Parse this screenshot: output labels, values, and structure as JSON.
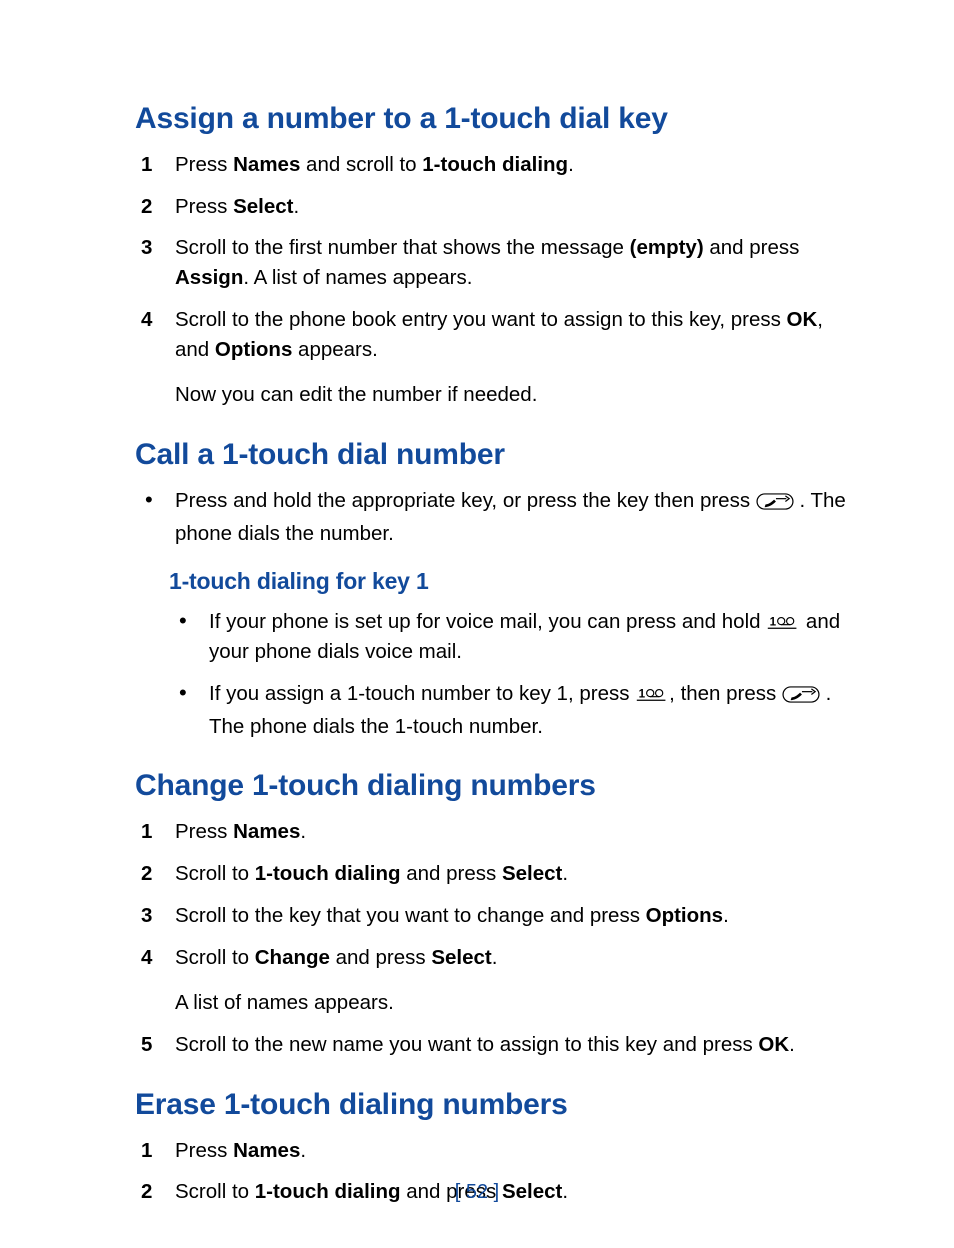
{
  "sections": {
    "assign": {
      "heading": "Assign a number to a 1-touch dial key",
      "steps": {
        "s1": {
          "t1": "Press ",
          "b1": "Names",
          "t2": " and scroll to ",
          "b2": "1-touch dialing",
          "t3": "."
        },
        "s2": {
          "t1": "Press ",
          "b1": "Select",
          "t2": "."
        },
        "s3": {
          "t1": "Scroll to the first number that shows the message ",
          "b1": "(empty)",
          "t2": " and press ",
          "b2": "Assign",
          "t3": ". A list of names appears."
        },
        "s4": {
          "t1": "Scroll to the phone book entry you want to assign to this key, press ",
          "b1": "OK",
          "t2": ", and ",
          "b2": "Options",
          "t3": " appears.",
          "after": "Now you can edit the number if needed."
        }
      }
    },
    "call": {
      "heading": "Call a 1-touch dial number",
      "b1": {
        "t1": "Press and hold the appropriate key, or press the key then press  ",
        "t2": " . The phone dials the number."
      },
      "sub_heading": "1-touch dialing for key 1",
      "sub_b1": {
        "t1": "If your phone is set up for voice mail, you can press and hold ",
        "t2": " and your phone dials voice mail."
      },
      "sub_b2": {
        "t1": "If you assign a 1-touch number to key 1, press ",
        "t2": ", then press  ",
        "t3": "  . The phone dials the 1-touch number."
      }
    },
    "change": {
      "heading": "Change 1-touch dialing numbers",
      "steps": {
        "s1": {
          "t1": "Press ",
          "b1": "Names",
          "t2": "."
        },
        "s2": {
          "t1": "Scroll to ",
          "b1": "1-touch dialing",
          "t2": " and press ",
          "b2": "Select",
          "t3": "."
        },
        "s3": {
          "t1": "Scroll to the key that you want to change and press ",
          "b1": "Options",
          "t2": "."
        },
        "s4": {
          "t1": "Scroll to ",
          "b1": "Change",
          "t2": " and press ",
          "b2": "Select",
          "t3": ".",
          "after": "A list of names appears."
        },
        "s5": {
          "t1": "Scroll to the new name you want to assign to this key and press ",
          "b1": "OK",
          "t2": "."
        }
      }
    },
    "erase": {
      "heading": "Erase 1-touch dialing numbers",
      "steps": {
        "s1": {
          "t1": "Press ",
          "b1": "Names",
          "t2": "."
        },
        "s2": {
          "t1": "Scroll to ",
          "b1": "1-touch dialing",
          "t2": " and press ",
          "b2": "Select",
          "t3": "."
        }
      }
    }
  },
  "page_number": "[ 52 ]"
}
